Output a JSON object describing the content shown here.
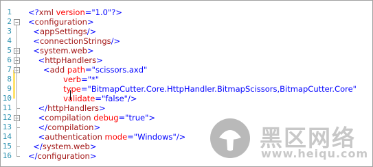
{
  "editor": {
    "line_numbers": [
      "1",
      "2",
      "3",
      "4",
      "5",
      "6",
      "7",
      "8",
      "9",
      "10",
      "11",
      "12",
      "13",
      "14",
      "15",
      "16"
    ],
    "lines": [
      [
        {
          "t": "<?",
          "c": "k"
        },
        {
          "t": "xml",
          "c": "t"
        },
        {
          "t": " version",
          "c": "a"
        },
        {
          "t": "=\"",
          "c": "k"
        },
        {
          "t": "1.0",
          "c": "v"
        },
        {
          "t": "\"?>",
          "c": "k"
        }
      ],
      [
        {
          "t": "<",
          "c": "k"
        },
        {
          "t": "configuration",
          "c": "t"
        },
        {
          "t": ">",
          "c": "k"
        }
      ],
      [
        {
          "t": "  <",
          "c": "k"
        },
        {
          "t": "appSettings",
          "c": "t"
        },
        {
          "t": "/>",
          "c": "k"
        }
      ],
      [
        {
          "t": "  <",
          "c": "k"
        },
        {
          "t": "connectionStrings",
          "c": "t"
        },
        {
          "t": "/>",
          "c": "k"
        }
      ],
      [
        {
          "t": "  <",
          "c": "k"
        },
        {
          "t": "system.web",
          "c": "t"
        },
        {
          "t": ">",
          "c": "k"
        }
      ],
      [
        {
          "t": "    <",
          "c": "k"
        },
        {
          "t": "httpHandlers",
          "c": "t"
        },
        {
          "t": ">",
          "c": "k"
        }
      ],
      [
        {
          "t": "      <",
          "c": "k"
        },
        {
          "t": "add",
          "c": "t"
        },
        {
          "t": " path",
          "c": "a"
        },
        {
          "t": "=\"",
          "c": "k"
        },
        {
          "t": "scissors.axd",
          "c": "v"
        },
        {
          "t": "\"",
          "c": "k"
        }
      ],
      [
        {
          "t": "              verb",
          "c": "a"
        },
        {
          "t": "=\"",
          "c": "k"
        },
        {
          "t": "*",
          "c": "v"
        },
        {
          "t": "\"",
          "c": "k"
        }
      ],
      [
        {
          "t": "              type",
          "c": "a"
        },
        {
          "t": "=\"",
          "c": "k"
        },
        {
          "t": "BitmapCutter.Core.HttpHandler.BitmapScissors,BitmapCutter.Core",
          "c": "v"
        },
        {
          "t": "\"",
          "c": "k"
        }
      ],
      [
        {
          "t": "              validate",
          "c": "a"
        },
        {
          "t": "=\"",
          "c": "k"
        },
        {
          "t": "false",
          "c": "v"
        },
        {
          "t": "\"/>",
          "c": "k"
        }
      ],
      [
        {
          "t": "    </",
          "c": "k"
        },
        {
          "t": "httpHandlers",
          "c": "t"
        },
        {
          "t": ">",
          "c": "k"
        }
      ],
      [
        {
          "t": "    <",
          "c": "k"
        },
        {
          "t": "compilation",
          "c": "t"
        },
        {
          "t": " debug",
          "c": "a"
        },
        {
          "t": "=\"",
          "c": "k"
        },
        {
          "t": "true",
          "c": "v"
        },
        {
          "t": "\">",
          "c": "k"
        }
      ],
      [
        {
          "t": "    </",
          "c": "k"
        },
        {
          "t": "compilation",
          "c": "t"
        },
        {
          "t": ">",
          "c": "k"
        }
      ],
      [
        {
          "t": "    <",
          "c": "k"
        },
        {
          "t": "authentication",
          "c": "t"
        },
        {
          "t": " mode",
          "c": "a"
        },
        {
          "t": "=\"",
          "c": "k"
        },
        {
          "t": "Windows",
          "c": "v"
        },
        {
          "t": "\"/>",
          "c": "k"
        }
      ],
      [
        {
          "t": "  </",
          "c": "k"
        },
        {
          "t": "system.web",
          "c": "t"
        },
        {
          "t": ">",
          "c": "k"
        }
      ],
      [
        {
          "t": "</",
          "c": "k"
        },
        {
          "t": "configuration",
          "c": "t"
        },
        {
          "t": ">",
          "c": "k"
        }
      ]
    ]
  },
  "watermark": {
    "title": "黑区网络",
    "url": "www.heiqu.com"
  },
  "colors": {
    "line_number": "#2b91af",
    "tag": "#a31515",
    "attribute": "#ff0000",
    "value": "#0000ff",
    "punctuation": "#0000ff",
    "change_marker": "#ffe36b"
  }
}
